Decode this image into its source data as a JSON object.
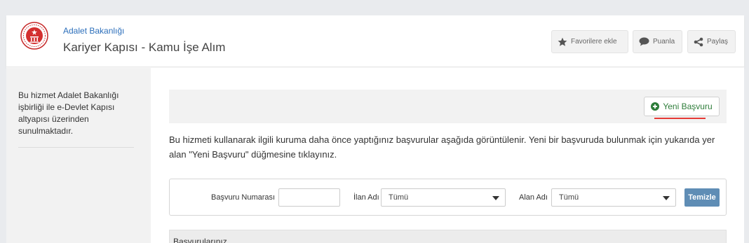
{
  "header": {
    "org_name": "Adalet Bakanlığı",
    "app_title": "Kariyer Kapısı - Kamu İşe Alım",
    "buttons": {
      "favorite": "Favorilere ekle",
      "rate": "Puanla",
      "share": "Paylaş"
    }
  },
  "sidebar": {
    "info": "Bu hizmet Adalet Bakanlığı işbirliği ile e-Devlet Kapısı altyapısı üzerinden sunulmaktadır."
  },
  "main": {
    "new_application_label": "Yeni Başvuru",
    "intro": "Bu hizmeti kullanarak ilgili kuruma daha önce yaptığınız başvurular aşağıda görüntülenir. Yeni bir başvuruda bulunmak için yukarıda yer alan \"Yeni Başvuru\" düğmesine tıklayınız.",
    "filters": {
      "application_number_label": "Başvuru Numarası",
      "application_number_value": "",
      "listing_label": "İlan Adı",
      "listing_value": "Tümü",
      "field_label": "Alan Adı",
      "field_value": "Tümü",
      "clear_label": "Temizle"
    },
    "list_title": "Başvurularınız"
  },
  "colors": {
    "accent_blue": "#2c6fbb",
    "green": "#2e7d3a",
    "underline_red": "#e53935",
    "clear_button": "#5f8db5"
  },
  "icons": [
    "emblem-icon",
    "star-icon",
    "speech-bubble-icon",
    "share-icon",
    "plus-circle-icon",
    "chevron-down-icon"
  ]
}
